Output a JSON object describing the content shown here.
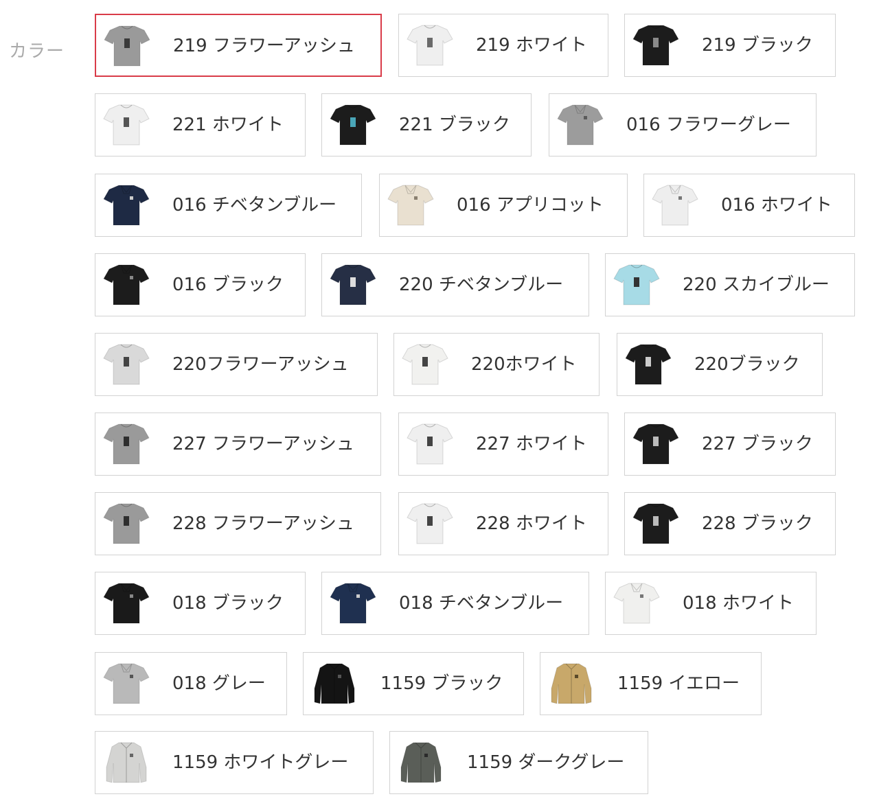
{
  "color_label": "カラー",
  "options": [
    {
      "label": "219 フラワーアッシュ",
      "color": "#9a9a9a",
      "type": "tee",
      "print": "#3a3a3a",
      "selected": true
    },
    {
      "label": "219 ホワイト",
      "color": "#efefef",
      "type": "tee",
      "print": "#6a6a6a",
      "selected": false
    },
    {
      "label": "219 ブラック",
      "color": "#1c1c1c",
      "type": "tee",
      "print": "#8a8a8a",
      "selected": false
    },
    {
      "label": "221 ホワイト",
      "color": "#efefef",
      "type": "tee",
      "print": "#555555",
      "selected": false
    },
    {
      "label": "221 ブラック",
      "color": "#1c1c1c",
      "type": "tee",
      "print": "#4aa6b8",
      "selected": false
    },
    {
      "label": "016 フラワーグレー",
      "color": "#9c9c9c",
      "type": "polo",
      "print": "#5a5a5a",
      "selected": false
    },
    {
      "label": "016 チベタンブルー",
      "color": "#1e2a44",
      "type": "polo",
      "print": "#cccccc",
      "selected": false
    },
    {
      "label": "016 アプリコット",
      "color": "#e9e0d0",
      "type": "polo",
      "print": "#8a8070",
      "selected": false
    },
    {
      "label": "016 ホワイト",
      "color": "#eeeeee",
      "type": "polo",
      "print": "#777777",
      "selected": false
    },
    {
      "label": "016 ブラック",
      "color": "#1c1c1c",
      "type": "polo",
      "print": "#888888",
      "selected": false
    },
    {
      "label": "220 チベタンブルー",
      "color": "#262f45",
      "type": "tee",
      "print": "#dddddd",
      "selected": false
    },
    {
      "label": "220 スカイブルー",
      "color": "#a7dbe6",
      "type": "tee",
      "print": "#333333",
      "selected": false
    },
    {
      "label": "220フラワーアッシュ",
      "color": "#d9d9d9",
      "type": "tee",
      "print": "#444444",
      "selected": false
    },
    {
      "label": "220ホワイト",
      "color": "#f1f1ef",
      "type": "tee",
      "print": "#444444",
      "selected": false
    },
    {
      "label": "220ブラック",
      "color": "#1c1c1c",
      "type": "tee",
      "print": "#cccccc",
      "selected": false
    },
    {
      "label": "227 フラワーアッシュ",
      "color": "#9a9a9a",
      "type": "tee",
      "print": "#2e2e2e",
      "selected": false
    },
    {
      "label": "227 ホワイト",
      "color": "#efefef",
      "type": "tee",
      "print": "#444444",
      "selected": false
    },
    {
      "label": "227 ブラック",
      "color": "#1c1c1c",
      "type": "tee",
      "print": "#bbbbbb",
      "selected": false
    },
    {
      "label": "228 フラワーアッシュ",
      "color": "#9a9a9a",
      "type": "tee",
      "print": "#2e2e2e",
      "selected": false
    },
    {
      "label": "228 ホワイト",
      "color": "#efefef",
      "type": "tee",
      "print": "#444444",
      "selected": false
    },
    {
      "label": "228 ブラック",
      "color": "#1c1c1c",
      "type": "tee",
      "print": "#bbbbbb",
      "selected": false
    },
    {
      "label": "018 ブラック",
      "color": "#1a1a1a",
      "type": "polo",
      "print": "#888888",
      "selected": false
    },
    {
      "label": "018 チベタンブルー",
      "color": "#1f3050",
      "type": "polo",
      "print": "#cccccc",
      "selected": false
    },
    {
      "label": "018 ホワイト",
      "color": "#f0f0ee",
      "type": "polo",
      "print": "#777777",
      "selected": false
    },
    {
      "label": "018 グレー",
      "color": "#b9b9b9",
      "type": "polo",
      "print": "#555555",
      "selected": false
    },
    {
      "label": "1159 ブラック",
      "color": "#141414",
      "type": "shirt",
      "print": "#555555",
      "selected": false
    },
    {
      "label": "1159 イエロー",
      "color": "#c8a86a",
      "type": "shirt",
      "print": "#5a4a2a",
      "selected": false
    },
    {
      "label": "1159 ホワイトグレー",
      "color": "#d4d4d2",
      "type": "shirt",
      "print": "#666666",
      "selected": false
    },
    {
      "label": "1159 ダークグレー",
      "color": "#5a5e58",
      "type": "shirt",
      "print": "#2a2a2a",
      "selected": false
    }
  ]
}
